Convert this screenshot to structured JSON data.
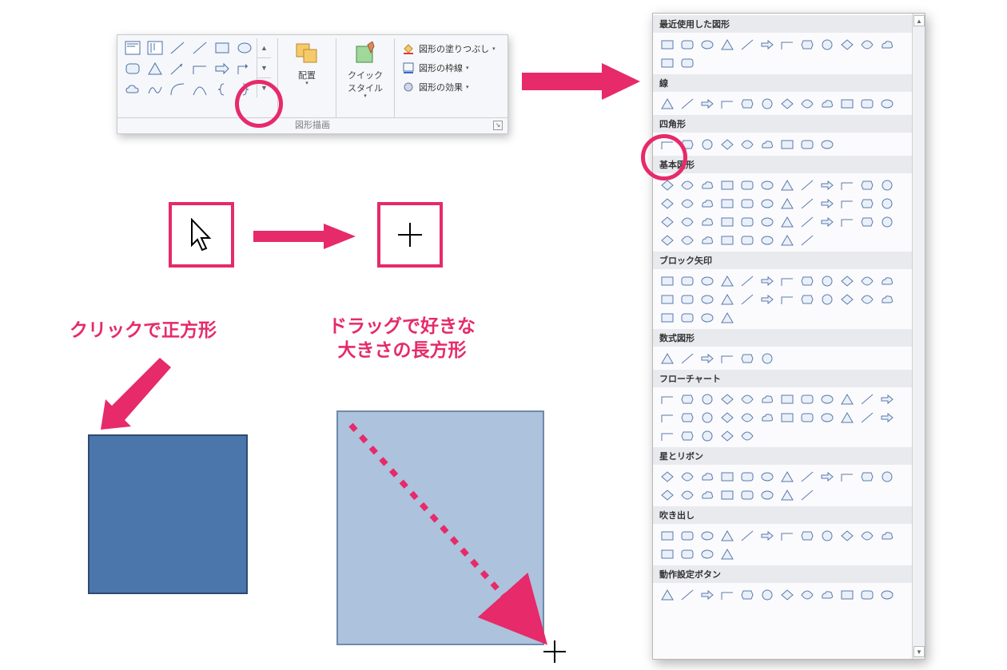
{
  "ribbon": {
    "group_label": "図形描画",
    "gallery_icons": [
      "textbox",
      "vtextbox",
      "line",
      "line2",
      "rect",
      "oval",
      "roundrect",
      "triangle",
      "arrowline",
      "elbow",
      "right-arrow",
      "orthogonal",
      "cloud",
      "scribble",
      "arc",
      "curve",
      "brace-l",
      "brace-r"
    ],
    "gallery_scroll": {
      "up": "▲",
      "down": "▼",
      "more": "▼"
    },
    "arrange_label": "配置",
    "quickstyle_line1": "クイック",
    "quickstyle_line2": "スタイル",
    "fill_label": "図形の塗りつぶし",
    "outline_label": "図形の枠線",
    "effects_label": "図形の効果",
    "dropdown_glyph": "▾"
  },
  "label_click": "クリックで正方形",
  "label_drag_line1": "ドラッグで好きな",
  "label_drag_line2": "大きさの長方形",
  "dropdown": {
    "sections": [
      {
        "title": "最近使用した図形",
        "rows": 14
      },
      {
        "title": "線",
        "rows": 12
      },
      {
        "title": "四角形",
        "rows": 9
      },
      {
        "title": "基本図形",
        "rows": 44
      },
      {
        "title": "ブロック矢印",
        "rows": 28
      },
      {
        "title": "数式図形",
        "rows": 6
      },
      {
        "title": "フローチャート",
        "rows": 29
      },
      {
        "title": "星とリボン",
        "rows": 20
      },
      {
        "title": "吹き出し",
        "rows": 16
      },
      {
        "title": "動作設定ボタン",
        "rows": 12
      }
    ],
    "scroll_up": "▲",
    "scroll_down": "▼"
  },
  "pink": "#e62a6a"
}
